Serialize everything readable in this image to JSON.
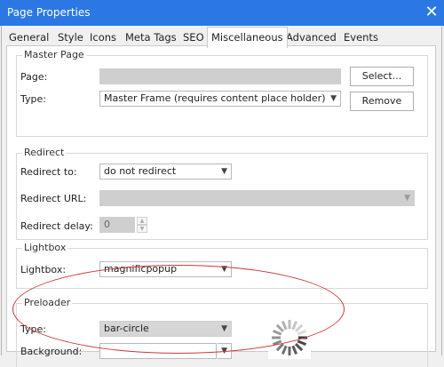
{
  "window": {
    "title": "Page Properties",
    "close_glyph": "✕"
  },
  "tabs": [
    {
      "label": "General"
    },
    {
      "label": "Style"
    },
    {
      "label": "Icons"
    },
    {
      "label": "Meta Tags"
    },
    {
      "label": "SEO"
    },
    {
      "label": "Miscellaneous",
      "active": true
    },
    {
      "label": "Advanced"
    },
    {
      "label": "Events"
    }
  ],
  "master_page": {
    "title": "Master Page",
    "page_label": "Page:",
    "page_value": "",
    "type_label": "Type:",
    "type_value": "Master Frame (requires content place holder)",
    "select_button": "Select...",
    "remove_button": "Remove"
  },
  "redirect": {
    "title": "Redirect",
    "to_label": "Redirect to:",
    "to_value": "do not redirect",
    "url_label": "Redirect URL:",
    "url_value": "",
    "delay_label": "Redirect delay:",
    "delay_value": "0"
  },
  "lightbox": {
    "title": "Lightbox",
    "label": "Lightbox:",
    "value": "magnificpopup"
  },
  "preloader": {
    "title": "Preloader",
    "type_label": "Type:",
    "type_value": "bar-circle",
    "background_label": "Background:",
    "background_value": ""
  },
  "icons": {
    "close": "close-icon",
    "dropdown": "chevron-down-icon",
    "spinner": "loading-spinner-icon"
  },
  "colors": {
    "titlebar": "#2b78e4",
    "annotation": "#c73a3a"
  }
}
